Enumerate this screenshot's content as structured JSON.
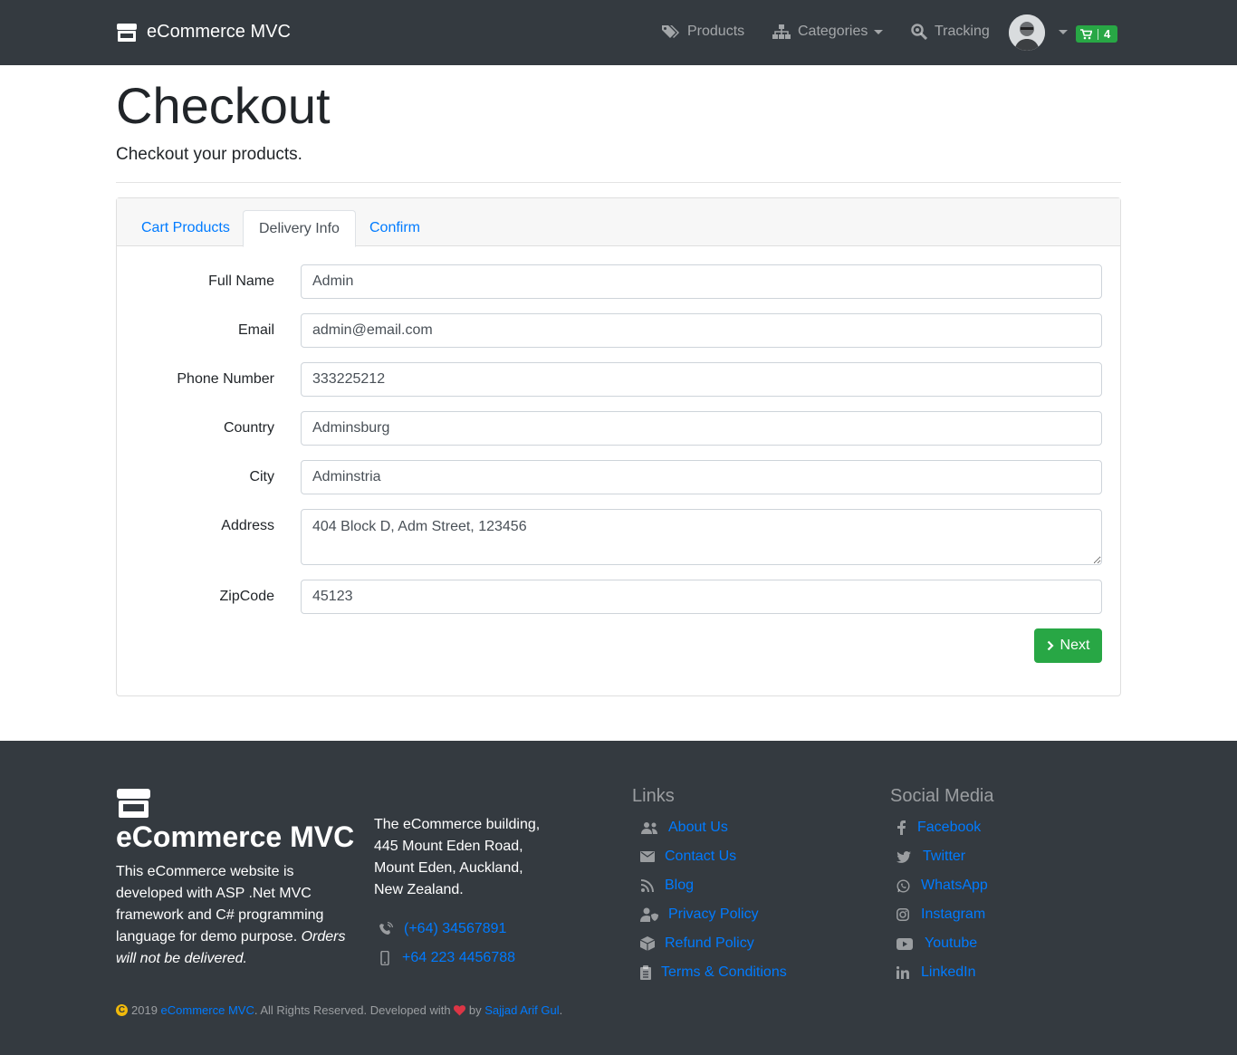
{
  "navbar": {
    "brand": "eCommerce MVC",
    "products": "Products",
    "categories": "Categories",
    "tracking": "Tracking",
    "cart_count": "4"
  },
  "header": {
    "title": "Checkout",
    "subtitle": "Checkout your products."
  },
  "tabs": [
    "Cart Products",
    "Delivery Info",
    "Confirm"
  ],
  "form": {
    "full_name": {
      "label": "Full Name",
      "value": "Admin"
    },
    "email": {
      "label": "Email",
      "value": "admin@email.com"
    },
    "phone": {
      "label": "Phone Number",
      "value": "333225212"
    },
    "country": {
      "label": "Country",
      "value": "Adminsburg"
    },
    "city": {
      "label": "City",
      "value": "Adminstria"
    },
    "address": {
      "label": "Address",
      "value": "404 Block D, Adm Street, 123456"
    },
    "zip": {
      "label": "ZipCode",
      "value": "45123"
    },
    "next_label": "Next"
  },
  "footer": {
    "brand": "eCommerce MVC",
    "desc": "This eCommerce website is developed with ASP .Net MVC framework and C# programming language for demo purpose.",
    "desc_em": "Orders will not be delivered.",
    "address": "The eCommerce building, 445 Mount Eden Road, Mount Eden, Auckland, New Zealand.",
    "phone": "(+64) 34567891",
    "mobile": "+64 223 4456788",
    "links_heading": "Links",
    "links": [
      "About Us",
      "Contact Us",
      "Blog",
      "Privacy Policy",
      "Refund Policy",
      "Terms & Conditions"
    ],
    "social_heading": "Social Media",
    "social": [
      "Facebook",
      "Twitter",
      "WhatsApp",
      "Instagram",
      "Youtube",
      "LinkedIn"
    ],
    "copy_year": "2019",
    "copy_brand": "eCommerce MVC",
    "copy_text": ". All Rights Reserved. Developed with",
    "copy_by": "by",
    "copy_author": "Sajjad Arif Gul",
    "copy_end": "."
  },
  "colors": {
    "navbar_bg": "#343a40",
    "primary": "#007bff",
    "success": "#28a745"
  },
  "icons": {
    "brand": "store-icon",
    "products": "tags-icon",
    "categories": "sitemap-icon",
    "tracking": "search-location-icon",
    "cart": "shopping-cart-icon",
    "next": "chevron-right-icon"
  }
}
